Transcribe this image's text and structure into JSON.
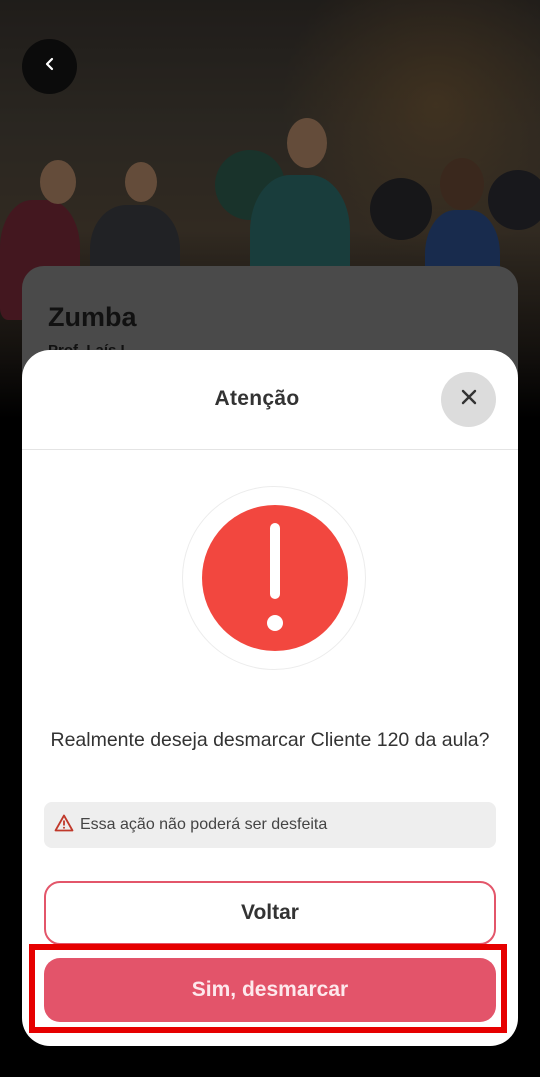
{
  "hero": {
    "image_alt": "zumba-class-photo"
  },
  "class_card": {
    "title": "Zumba",
    "professor": "Prof. Laís L."
  },
  "modal": {
    "title": "Atenção",
    "icon": "exclamation-icon",
    "message": "Realmente deseja desmarcar Cliente 120 da aula?",
    "warning": "Essa ação não poderá ser desfeita",
    "back_button": "Voltar",
    "confirm_button": "Sim, desmarcar"
  },
  "colors": {
    "accent": "#e3546a",
    "alert": "#f2473f",
    "highlight": "#e60000"
  }
}
